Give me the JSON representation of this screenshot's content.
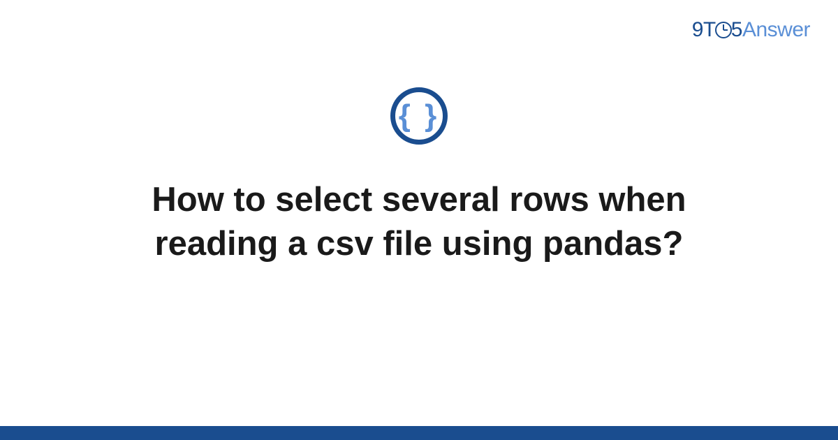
{
  "logo": {
    "nine_t": "9T",
    "five": "5",
    "answer": "Answer"
  },
  "badge": {
    "symbol": "{ }",
    "icon_name": "code-braces-icon"
  },
  "title": "How to select several rows when reading a csv file using pandas?",
  "colors": {
    "brand_dark": "#1a4d8f",
    "brand_light": "#5a8fd6"
  }
}
